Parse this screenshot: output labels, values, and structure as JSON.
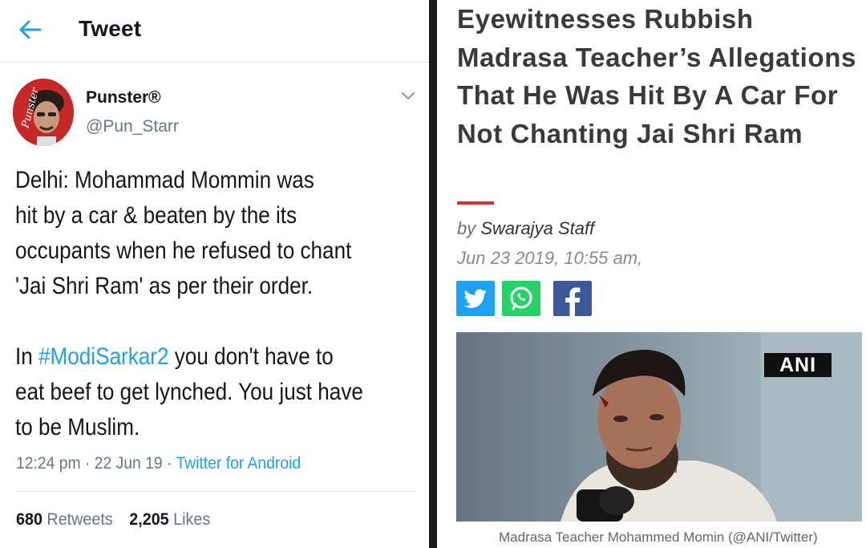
{
  "tweet": {
    "header_title": "Tweet",
    "author_name": "Punster®",
    "author_handle": "@Pun_Starr",
    "avatar_label": "Punster",
    "text_lines": [
      "Delhi: Mohammad Mommin was",
      "hit by a car & beaten by the its",
      "occupants when he refused to chant",
      "'Jai Shri Ram' as per their order."
    ],
    "text_line5_before": "In ",
    "hashtag": "#ModiSarkar2",
    "text_line5_after": " you don't have to",
    "text_lines_end": [
      "eat beef to get lynched. You just have",
      "to be Muslim."
    ],
    "time": "12:24 pm",
    "sep": " · ",
    "date": "22 Jun 19",
    "source": "Twitter for Android",
    "retweets_count": "680",
    "retweets_label": "Retweets",
    "likes_count": "2,205",
    "likes_label": "Likes"
  },
  "article": {
    "headline": "Eyewitnesses Rubbish Madrasa Teacher’s Allegations That He Was Hit By A Car For Not Chanting Jai Shri Ram",
    "by_prefix": "by ",
    "author": "Swarajya Staff",
    "date": "Jun 23 2019, 10:55 am,",
    "photo_badge": "ANI",
    "caption": "Madrasa Teacher Mohammed Momin (@ANI/Twitter)"
  },
  "colors": {
    "twitter_blue": "#1da1f2",
    "accent_red": "#d9302f",
    "whatsapp_green": "#25d366",
    "facebook_blue": "#3b5998"
  },
  "icons": [
    "back-arrow-icon",
    "chevron-down-icon",
    "twitter-icon",
    "whatsapp-icon",
    "facebook-icon"
  ]
}
